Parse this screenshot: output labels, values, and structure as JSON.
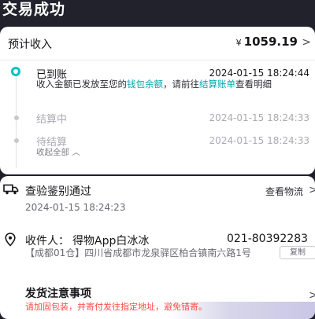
{
  "header": {
    "title": "交易成功",
    "watermark_icon": "copyright-icon"
  },
  "income": {
    "label": "预计收入",
    "currency": "¥",
    "amount": "1059.19",
    "chevron": ">"
  },
  "timeline": {
    "steps": [
      {
        "title": "已到账",
        "time": "2024-01-15 18:24:44",
        "state": "active"
      },
      {
        "title": "结算中",
        "time": "2024-01-15 18:24:33",
        "state": "done"
      },
      {
        "title": "待结算",
        "time": "2024-01-15 18:24:33",
        "state": "done"
      }
    ],
    "description": {
      "p1": "收入金额已发放至您的",
      "link1": "钱包余额",
      "p2": "，请前往",
      "link2": "结算账单",
      "p3": "查看明细"
    },
    "collapse_label": "收起全部 ︿"
  },
  "verification": {
    "title": "查验鉴别通过",
    "time": "2024-01-15 18:24:23",
    "logistics_label": "查看物流",
    "chevron": ">"
  },
  "receiver": {
    "label": "收件人：",
    "name": "得物App白冰冰",
    "phone": "021-80392283",
    "address": "【成都01仓】四川省成都市龙泉驿区柏合镇南六路1号",
    "copy_label": "复制"
  },
  "notice": {
    "title": "发货注意事项",
    "text": "请加固包装，并寄付发往指定地址，避免错寄。",
    "chevron": ">"
  },
  "colors": {
    "accent": "#01c2c3",
    "link": "#01a9ab",
    "warning": "#ff4a4a",
    "header_bg": "#22222d"
  }
}
